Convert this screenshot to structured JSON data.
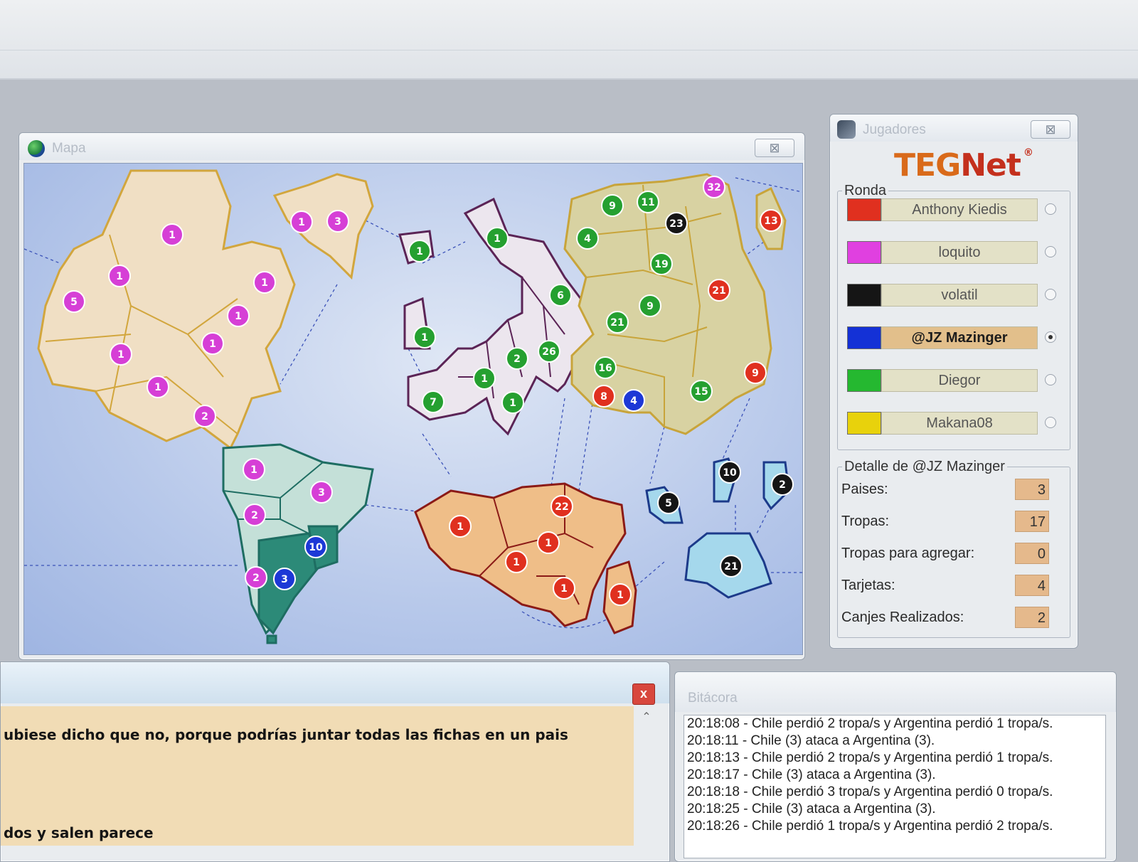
{
  "map_window": {
    "title": "Mapa",
    "close_label": "⊠"
  },
  "players_window": {
    "title": "Jugadores",
    "close_label": "⊠"
  },
  "logo": {
    "part1": "TEG",
    "part2": "Net",
    "reg": "®"
  },
  "round": {
    "legend": "Ronda",
    "players": [
      {
        "name": "Anthony Kiedis",
        "color": "#e0301f",
        "active": false
      },
      {
        "name": "loquito",
        "color": "#e040e0",
        "active": false
      },
      {
        "name": "volatil",
        "color": "#151515",
        "active": false
      },
      {
        "name": "@JZ Mazinger",
        "color": "#1431d6",
        "active": true
      },
      {
        "name": "Diegor",
        "color": "#25b830",
        "active": false
      },
      {
        "name": "Makana08",
        "color": "#e8d20c",
        "active": false
      }
    ]
  },
  "detail": {
    "legend": "Detalle de @JZ Mazinger",
    "rows": [
      {
        "label": "Paises:",
        "value": "3"
      },
      {
        "label": "Tropas:",
        "value": "17"
      },
      {
        "label": "Tropas para agregar:",
        "value": "0"
      },
      {
        "label": "Tarjetas:",
        "value": "4"
      },
      {
        "label": "Canjes Realizados:",
        "value": "2"
      }
    ]
  },
  "chat": {
    "close_label": "x",
    "lines": [
      "ubiese dicho que no, porque podrías juntar todas las fichas en un pais",
      "dos y salen parece"
    ]
  },
  "log": {
    "title": "Bitácora",
    "lines": [
      "20:18:08 - Chile perdió 2 tropa/s y Argentina perdió 1 tropa/s.",
      "20:18:11 - Chile (3) ataca a Argentina (3).",
      "20:18:13 - Chile perdió 2 tropa/s y Argentina perdió 1 tropa/s.",
      "20:18:17 - Chile (3) ataca a Argentina (3).",
      "20:18:18 - Chile perdió 3 tropa/s y Argentina perdió 0 tropa/s.",
      "20:18:25 - Chile (3) ataca a Argentina (3).",
      "20:18:26 - Chile perdió 1 tropa/s y Argentina perdió 2 tropa/s."
    ]
  },
  "map": {
    "colors": {
      "red": "#e0301f",
      "magenta": "#d63fd6",
      "black": "#151515",
      "blue": "#1d38d6",
      "green": "#25a030"
    },
    "armies": [
      {
        "owner": "magenta",
        "count": "1"
      },
      {
        "owner": "magenta",
        "count": "1"
      },
      {
        "owner": "magenta",
        "count": "5"
      },
      {
        "owner": "magenta",
        "count": "1"
      },
      {
        "owner": "magenta",
        "count": "1"
      },
      {
        "owner": "magenta",
        "count": "1"
      },
      {
        "owner": "magenta",
        "count": "1"
      },
      {
        "owner": "magenta",
        "count": "1"
      },
      {
        "owner": "magenta",
        "count": "1"
      },
      {
        "owner": "magenta",
        "count": "2"
      },
      {
        "owner": "magenta",
        "count": "3"
      },
      {
        "owner": "magenta",
        "count": "1"
      },
      {
        "owner": "magenta",
        "count": "3"
      },
      {
        "owner": "magenta",
        "count": "2"
      },
      {
        "owner": "blue",
        "count": "10"
      },
      {
        "owner": "magenta",
        "count": "2"
      },
      {
        "owner": "blue",
        "count": "3"
      },
      {
        "owner": "green",
        "count": "1"
      },
      {
        "owner": "green",
        "count": "1"
      },
      {
        "owner": "green",
        "count": "1"
      },
      {
        "owner": "green",
        "count": "6"
      },
      {
        "owner": "green",
        "count": "2"
      },
      {
        "owner": "green",
        "count": "26"
      },
      {
        "owner": "green",
        "count": "1"
      },
      {
        "owner": "green",
        "count": "7"
      },
      {
        "owner": "green",
        "count": "1"
      },
      {
        "owner": "green",
        "count": "9"
      },
      {
        "owner": "green",
        "count": "11"
      },
      {
        "owner": "black",
        "count": "23"
      },
      {
        "owner": "magenta",
        "count": "32"
      },
      {
        "owner": "red",
        "count": "13"
      },
      {
        "owner": "green",
        "count": "4"
      },
      {
        "owner": "green",
        "count": "19"
      },
      {
        "owner": "red",
        "count": "21"
      },
      {
        "owner": "green",
        "count": "9"
      },
      {
        "owner": "green",
        "count": "21"
      },
      {
        "owner": "green",
        "count": "16"
      },
      {
        "owner": "red",
        "count": "8"
      },
      {
        "owner": "blue",
        "count": "4"
      },
      {
        "owner": "green",
        "count": "15"
      },
      {
        "owner": "red",
        "count": "9"
      },
      {
        "owner": "red",
        "count": "1"
      },
      {
        "owner": "red",
        "count": "22"
      },
      {
        "owner": "red",
        "count": "1"
      },
      {
        "owner": "red",
        "count": "1"
      },
      {
        "owner": "red",
        "count": "1"
      },
      {
        "owner": "red",
        "count": "1"
      },
      {
        "owner": "black",
        "count": "10"
      },
      {
        "owner": "black",
        "count": "2"
      },
      {
        "owner": "black",
        "count": "5"
      },
      {
        "owner": "black",
        "count": "21"
      }
    ]
  }
}
